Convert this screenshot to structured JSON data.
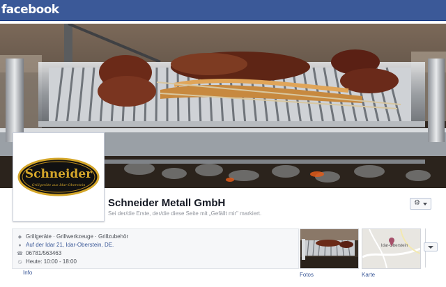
{
  "topbar": {
    "logo_text": "facebook",
    "color": "#3b5998"
  },
  "cover": {
    "alt": "cover-photo grill with meat"
  },
  "profile": {
    "logo_text": "Schneider",
    "logo_tagline": "Grillgeräte aus Idar-Oberstein"
  },
  "page": {
    "title": "Schneider Metall GmbH",
    "subtitle": "Sei der/die Erste, der/die diese Seite mit „Gefällt mir\" markiert."
  },
  "settings": {
    "icon": "gear-icon"
  },
  "info": {
    "category": "Grillgeräte · Grillwerkzeuge · Grillzubehör",
    "address": "Auf der Idar 21, Idar-Oberstein, DE.",
    "phone": "06781/563463",
    "hours": "Heute: 10:00 - 18:00",
    "link_label": "Info"
  },
  "apps": [
    {
      "label": "Fotos"
    },
    {
      "label": "Karte",
      "map_place": "Idar-Oberstein"
    }
  ]
}
